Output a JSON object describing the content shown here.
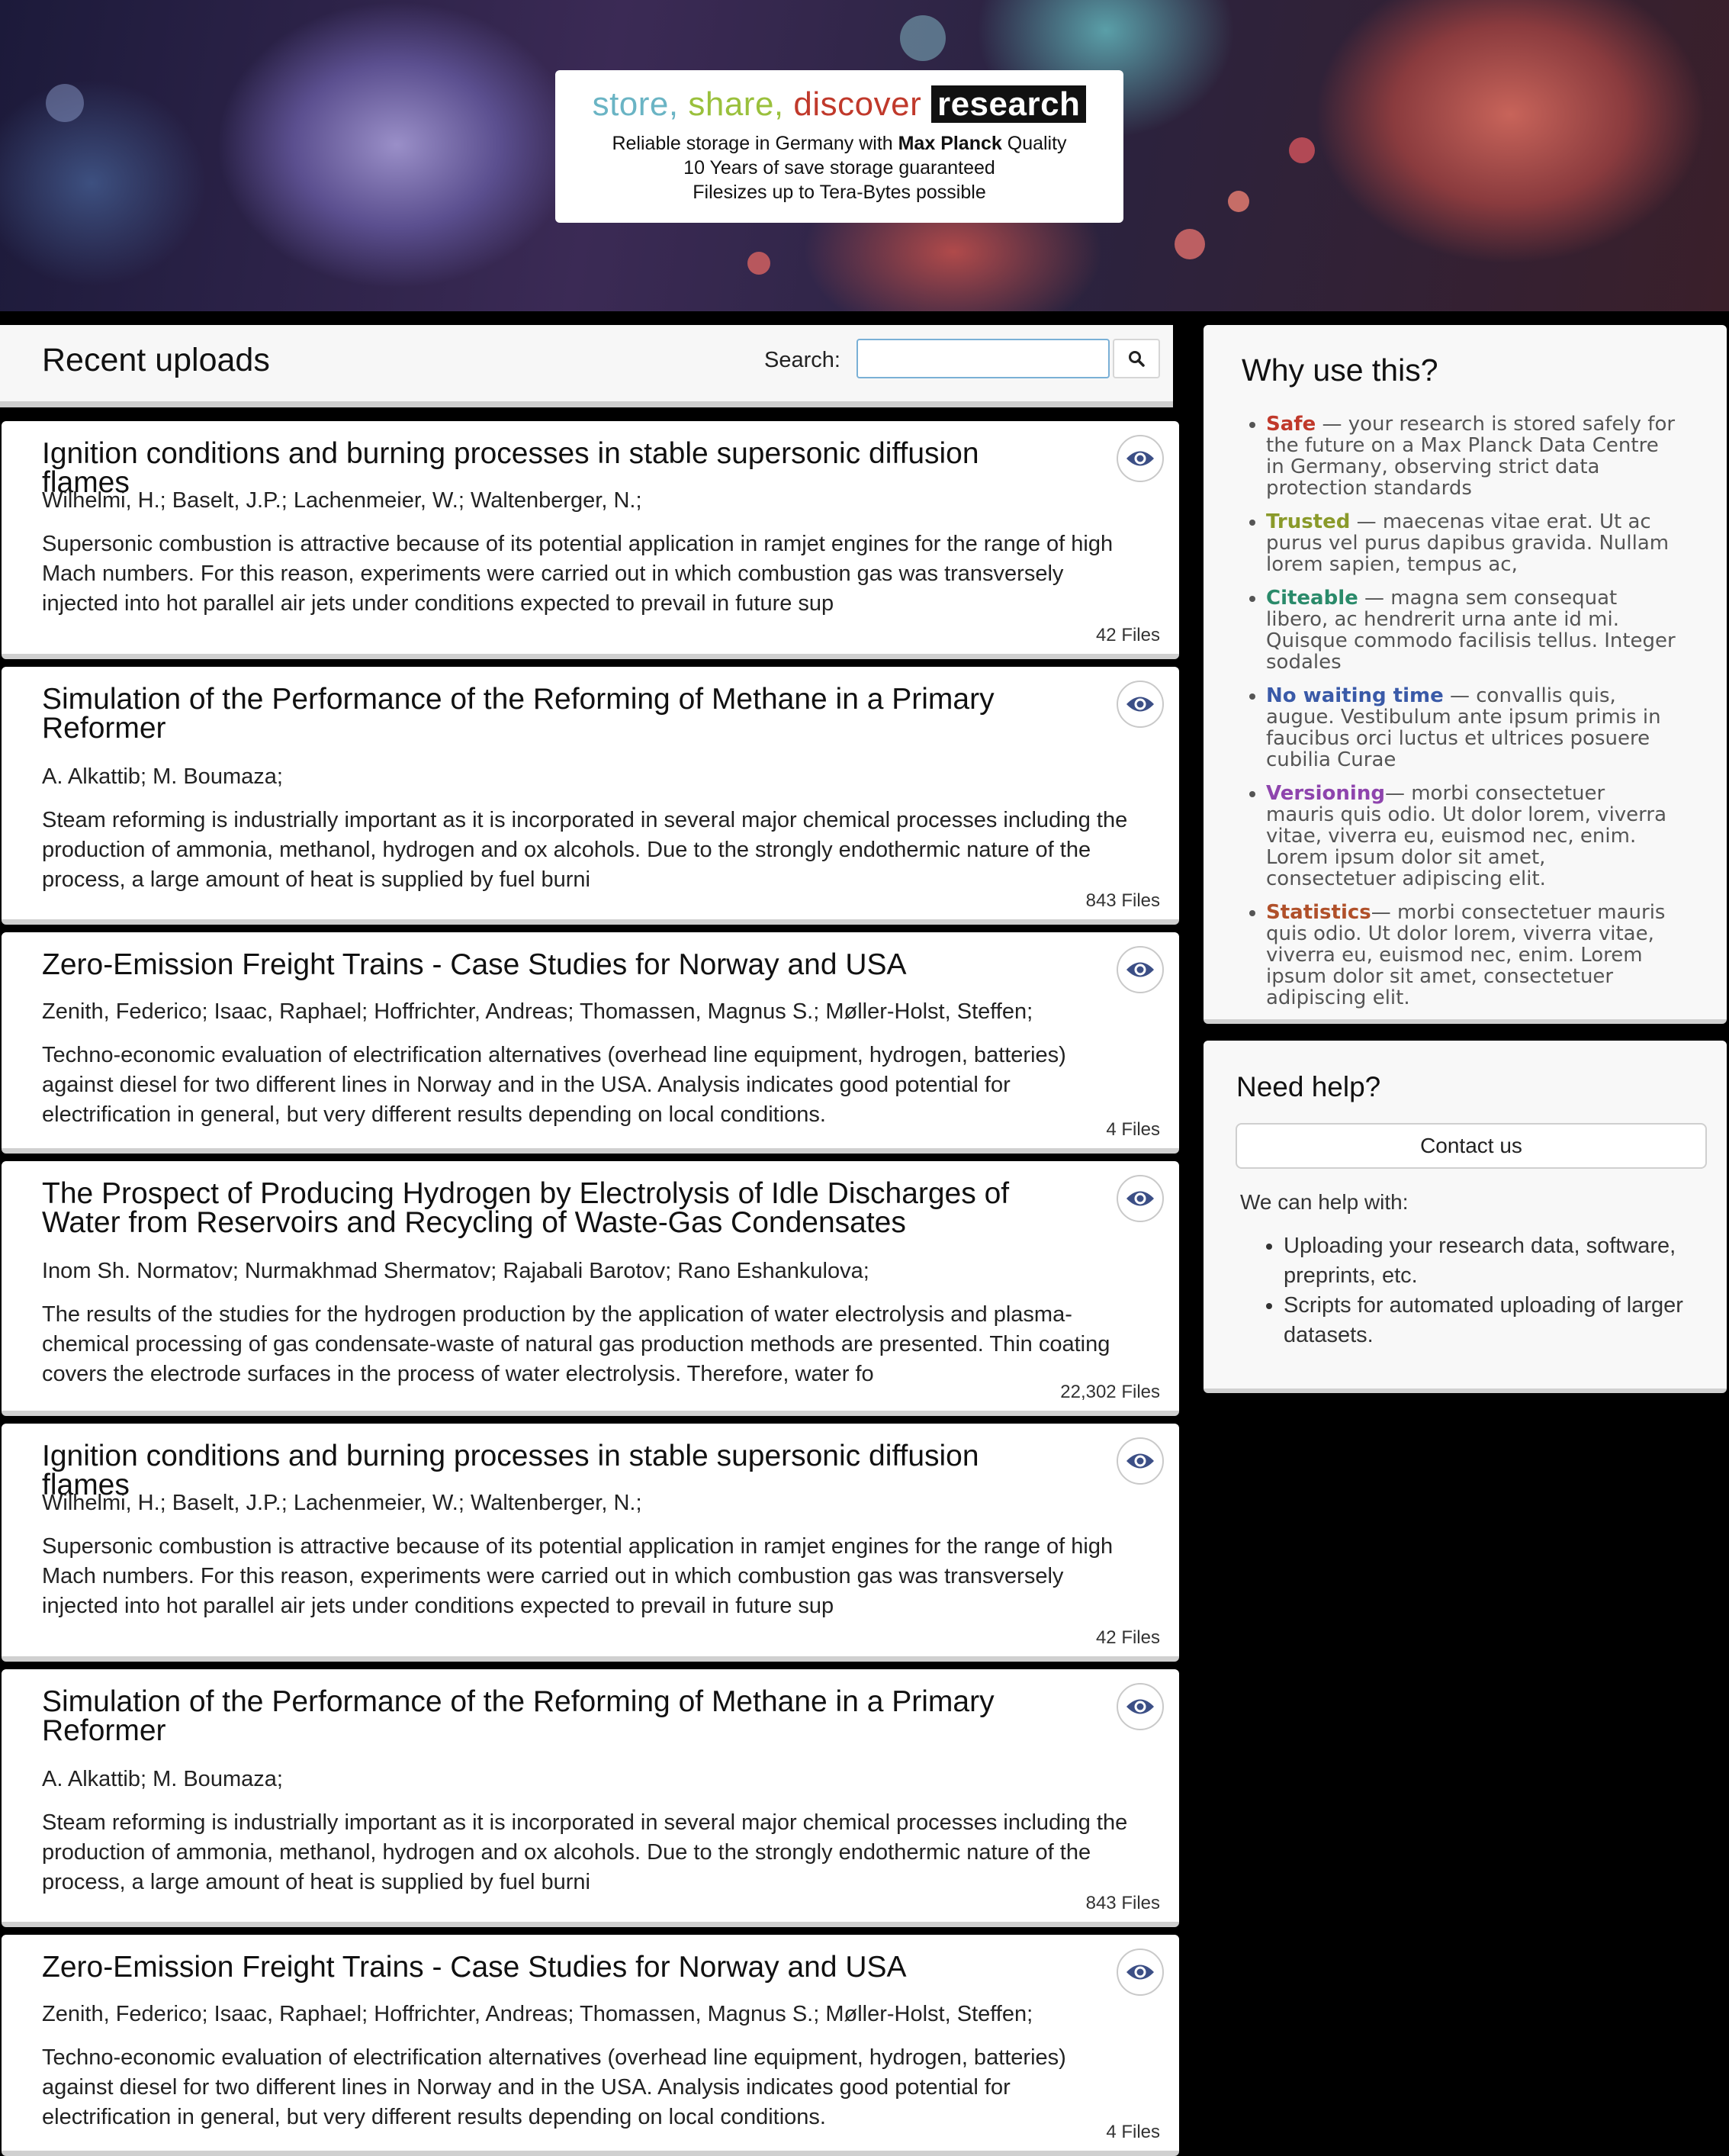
{
  "banner": {
    "tagline": {
      "store": "store,",
      "share": "share,",
      "discover": "discover",
      "research": "research"
    },
    "line1_pre": "Reliable storage in Germany with ",
    "line1_bold": "Max Planck",
    "line1_post": " Quality",
    "line2": "10 Years of save storage guaranteed",
    "line3": "Filesizes up to Tera-Bytes possible"
  },
  "uploads": {
    "title": "Recent uploads",
    "search_label": "Search:",
    "search_value": "",
    "search_icon": "search-icon",
    "view_icon": "eye-icon",
    "records": [
      {
        "title": "Ignition conditions and burning processes in stable supersonic diffusion flames",
        "authors": "Wilhelmi, H.; Baselt, J.P.; Lachenmeier, W.; Waltenberger, N.;",
        "abstract": "Supersonic combustion is attractive because of its potential application in ramjet engines for the range of high Mach numbers. For this reason, experiments were carried out in which combustion gas was transversely injected into hot parallel air jets under conditions expected to prevail in future sup",
        "files": "42 Files"
      },
      {
        "title": "Simulation of the Performance of the Reforming of Methane in a Primary Reformer",
        "authors": "A. Alkattib; M. Boumaza;",
        "abstract": "Steam reforming is industrially important as it is  incorporated in several major chemical processes including the production of ammonia, methanol, hydrogen and ox alcohols. Due to  the strongly endothermic nature of the process, a large amount of heat  is supplied by fuel burni",
        "files": "843 Files"
      },
      {
        "title": "Zero-Emission Freight Trains - Case Studies for Norway and USA",
        "authors": "Zenith, Federico; Isaac, Raphael; Hoffrichter, Andreas; Thomassen, Magnus S.; Møller-Holst, Steffen;",
        "abstract": "Techno-economic evaluation of electrification alternatives (overhead line equipment, hydrogen, batteries) against diesel for two different lines in Norway and in the USA. Analysis indicates good potential for electrification in general, but very different results depending on local conditions.",
        "files": "4 Files"
      },
      {
        "title": "The Prospect of Producing Hydrogen by Electrolysis of Idle Discharges of Water from Reservoirs and Recycling of Waste-Gas Condensates",
        "authors": "Inom Sh. Normatov; Nurmakhmad Shermatov; Rajabali Barotov; Rano Eshankulova;",
        "abstract": "The results of the studies for the hydrogen production by the application of water electrolysis and plasma-chemical processing of gas condensate-waste of natural gas production methods are presented. Thin coating covers the electrode surfaces in the process of water electrolysis. Therefore, water fo",
        "files": "22,302 Files"
      },
      {
        "title": "Ignition conditions and burning processes in stable supersonic diffusion flames",
        "authors": "Wilhelmi, H.; Baselt, J.P.; Lachenmeier, W.; Waltenberger, N.;",
        "abstract": "Supersonic combustion is attractive because of its potential application in ramjet engines for the range of high Mach numbers. For this reason, experiments were carried out in which combustion gas was transversely injected into hot parallel air jets under conditions expected to prevail in future sup",
        "files": "42 Files"
      },
      {
        "title": "Simulation of the Performance of the Reforming of Methane in a Primary Reformer",
        "authors": "A. Alkattib; M. Boumaza;",
        "abstract": "Steam reforming is industrially important as it is  incorporated in several major chemical processes including the production of ammonia, methanol, hydrogen and ox alcohols. Due to  the strongly endothermic nature of the process, a large amount of heat  is supplied by fuel burni",
        "files": "843 Files"
      },
      {
        "title": "Zero-Emission Freight Trains - Case Studies for Norway and USA",
        "authors": "Zenith, Federico; Isaac, Raphael; Hoffrichter, Andreas; Thomassen, Magnus S.; Møller-Holst, Steffen;",
        "abstract": "Techno-economic evaluation of electrification alternatives (overhead line equipment, hydrogen, batteries) against diesel for two different lines in Norway and in the USA. Analysis indicates good potential for electrification in general, but very different results depending on local conditions.",
        "files": "4 Files"
      }
    ]
  },
  "why": {
    "title": "Why use this?",
    "items": [
      {
        "key": "Safe",
        "color": "#c0392b",
        "text": " — your research is stored safely for the future on a Max Planck Data Centre in Germany, observing strict data protection standards"
      },
      {
        "key": "Trusted",
        "color": "#8a9a2a",
        "text": " — maecenas vitae erat. Ut ac purus vel purus dapibus gravida. Nullam lorem sapien, tempus ac,"
      },
      {
        "key": "Citeable",
        "color": "#2a8a6a",
        "text": " — magna sem consequat libero, ac hendrerit urna ante id mi. Quisque commodo facilisis tellus. Integer sodales"
      },
      {
        "key": "No waiting time",
        "color": "#3a5aa8",
        "text": " — convallis quis, augue. Vestibulum ante ipsum primis in faucibus orci luctus et ultrices posuere cubilia Curae"
      },
      {
        "key": "Versioning",
        "color": "#8e44ad",
        "text": "— morbi consectetuer mauris quis odio. Ut dolor lorem, viverra vitae, viverra eu, euismod nec, enim. Lorem ipsum dolor sit amet, consectetuer adipiscing elit."
      },
      {
        "key": "Statistics",
        "color": "#b0502a",
        "text": "— morbi consectetuer mauris quis odio. Ut dolor lorem, viverra vitae, viverra eu, euismod nec, enim. Lorem ipsum dolor sit amet, consectetuer adipiscing elit."
      }
    ]
  },
  "help": {
    "title": "Need help?",
    "contact_label": "Contact us",
    "intro": "We can help with:",
    "items": [
      "Uploading your research data, software, preprints, etc.",
      "Scripts for automated uploading of larger datasets."
    ]
  }
}
